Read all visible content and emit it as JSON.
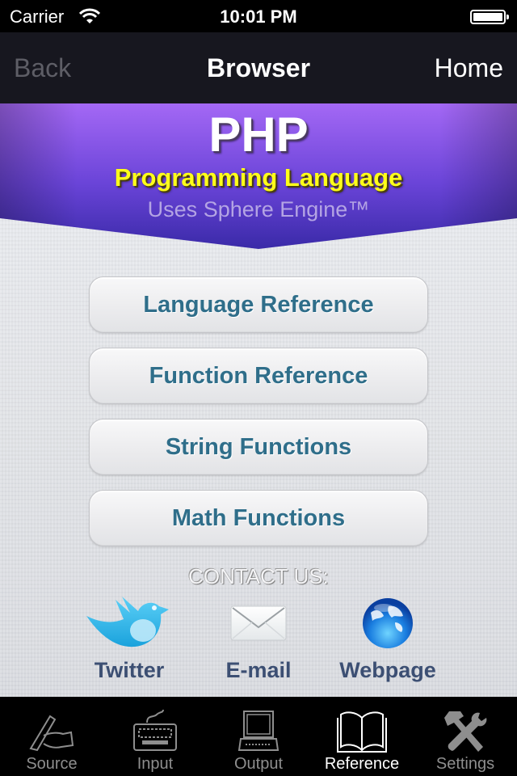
{
  "status_bar": {
    "carrier": "Carrier",
    "time": "10:01 PM",
    "battery_percent": 100
  },
  "nav_bar": {
    "back_label": "Back",
    "title": "Browser",
    "home_label": "Home"
  },
  "banner": {
    "title": "PHP",
    "subtitle": "Programming Language",
    "engine": "Uses Sphere Engine™",
    "colors": {
      "top": "#a468f5",
      "bottom": "#3f2fb0",
      "subtitle": "#ffff1a"
    }
  },
  "menu": {
    "items": [
      {
        "label": "Language Reference"
      },
      {
        "label": "Function Reference"
      },
      {
        "label": "String Functions"
      },
      {
        "label": "Math Functions"
      }
    ]
  },
  "contact": {
    "heading": "CONTACT US:",
    "items": [
      {
        "label": "Twitter",
        "icon": "twitter-bird-icon"
      },
      {
        "label": "E-mail",
        "icon": "envelope-icon"
      },
      {
        "label": "Webpage",
        "icon": "globe-icon"
      }
    ]
  },
  "tab_bar": {
    "active": "Reference",
    "tabs": [
      {
        "label": "Source",
        "icon": "hand-writing-icon"
      },
      {
        "label": "Input",
        "icon": "keyboard-icon"
      },
      {
        "label": "Output",
        "icon": "computer-terminal-icon"
      },
      {
        "label": "Reference",
        "icon": "open-book-icon"
      },
      {
        "label": "Settings",
        "icon": "tools-icon"
      }
    ]
  }
}
